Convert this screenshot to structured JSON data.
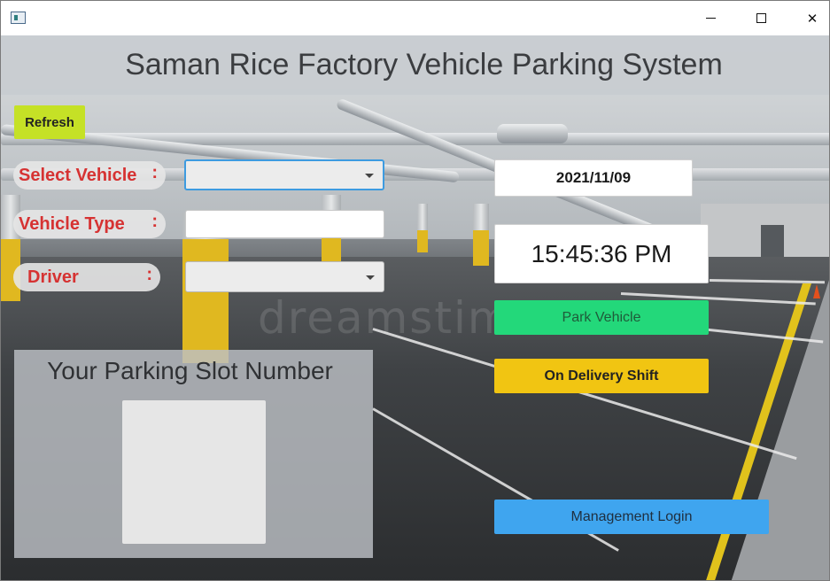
{
  "window": {
    "minimize_symbol": "—",
    "maximize_symbol": "☐",
    "close_symbol": "✕"
  },
  "app": {
    "title": "Saman Rice Factory Vehicle Parking System"
  },
  "toolbar": {
    "refresh_label": "Refresh"
  },
  "form": {
    "select_vehicle_label": "Select Vehicle",
    "vehicle_type_label": "Vehicle Type",
    "driver_label": "Driver",
    "colon": ":",
    "select_vehicle_value": "",
    "vehicle_type_value": "",
    "driver_value": ""
  },
  "clock": {
    "date": "2021/11/09",
    "time": "15:45:36 PM"
  },
  "actions": {
    "park_label": "Park Vehicle",
    "delivery_label": "On Delivery Shift",
    "login_label": "Management Login"
  },
  "slot": {
    "title": "Your Parking Slot Number",
    "value": ""
  },
  "background": {
    "watermark": "dreamstime"
  },
  "colors": {
    "refresh": "#c5e126",
    "label_text": "#d63232",
    "park": "#23d87a",
    "delivery": "#f1c512",
    "login": "#3fa5ef",
    "combo_focus": "#3d9be0"
  },
  "icons": {
    "app": "app-window-icon",
    "dropdown": "chevron-down-icon"
  }
}
